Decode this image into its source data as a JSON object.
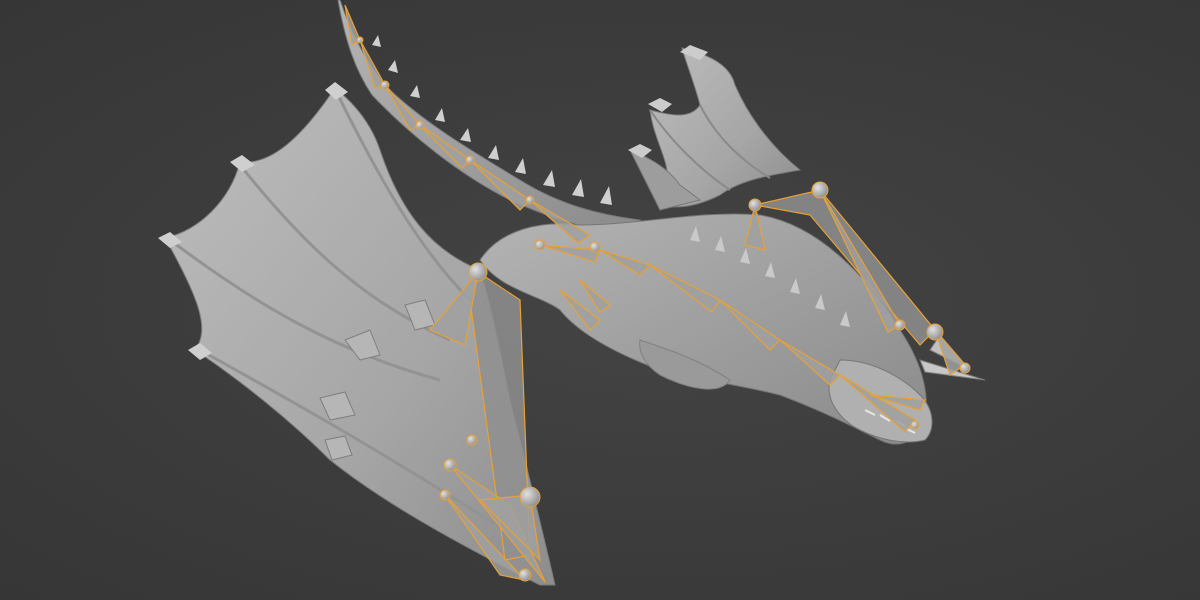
{
  "viewport": {
    "mode": "pose",
    "background_color": "#3d3d3d",
    "mesh_color": "#a9a9a9",
    "mesh_highlight": "#cfcfcf",
    "mesh_shadow": "#7c7c7c",
    "bone_outline_color": "#e8a135",
    "bone_fill_color": "#9a9a9a"
  },
  "model": {
    "subject": "dragon",
    "parts": [
      "tail",
      "left-wing",
      "right-wing",
      "body",
      "neck",
      "head",
      "armature"
    ]
  }
}
